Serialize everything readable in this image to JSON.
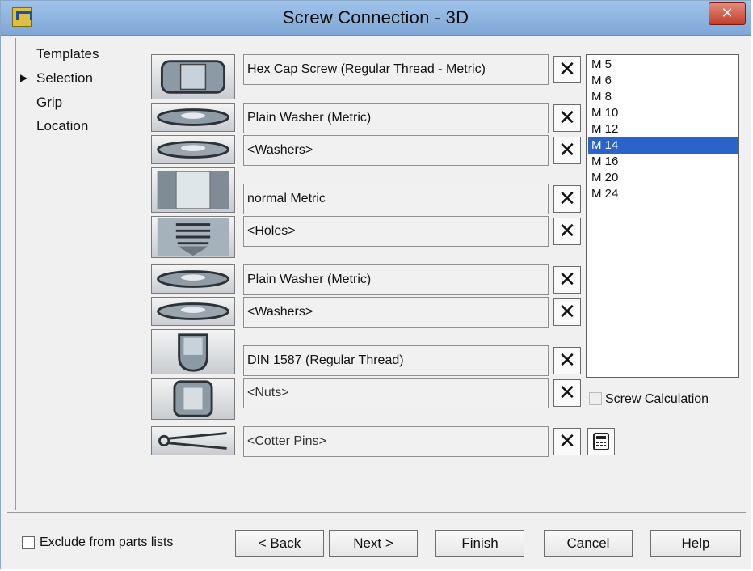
{
  "window": {
    "title": "Screw Connection - 3D",
    "close_glyph": "✕"
  },
  "nav": {
    "items": [
      {
        "label": "Templates",
        "active": false
      },
      {
        "label": "Selection",
        "active": true
      },
      {
        "label": "Grip",
        "active": false
      },
      {
        "label": "Location",
        "active": false
      }
    ]
  },
  "components": [
    {
      "value": "Hex Cap Screw (Regular Thread - Metric)",
      "icon": "hex-cap-screw-icon"
    },
    {
      "value": "Plain Washer (Metric)",
      "icon": "plain-washer-icon"
    },
    {
      "value": "<Washers>",
      "icon": "washer-icon"
    },
    {
      "value": "normal Metric",
      "icon": "hole-icon"
    },
    {
      "value": "<Holes>",
      "icon": "threaded-hole-icon"
    },
    {
      "value": "Plain Washer (Metric)",
      "icon": "plain-washer-icon"
    },
    {
      "value": "<Washers>",
      "icon": "washer-icon"
    },
    {
      "value": "DIN 1587  (Regular Thread)",
      "icon": "cap-nut-icon"
    },
    {
      "value": "<Nuts>",
      "icon": "hex-nut-icon"
    },
    {
      "value": "<Cotter Pins>",
      "icon": "cotter-pin-icon"
    }
  ],
  "clear_glyph": "✕",
  "sizes": {
    "items": [
      "M 5",
      "M 6",
      "M 8",
      "M 10",
      "M 12",
      "M 14",
      "M 16",
      "M 20",
      "M 24"
    ],
    "selected": "M 14"
  },
  "screw_calculation": {
    "label": "Screw Calculation",
    "checked": false,
    "enabled": false
  },
  "calculator_icon": "calculator-icon",
  "footer": {
    "exclude_label": "Exclude from parts lists",
    "exclude_checked": false,
    "buttons": {
      "back": "< Back",
      "next": "Next >",
      "finish": "Finish",
      "cancel": "Cancel",
      "help": "Help"
    }
  },
  "colors": {
    "selection": "#2a64c8",
    "titlebar": "#9fc3ea"
  }
}
